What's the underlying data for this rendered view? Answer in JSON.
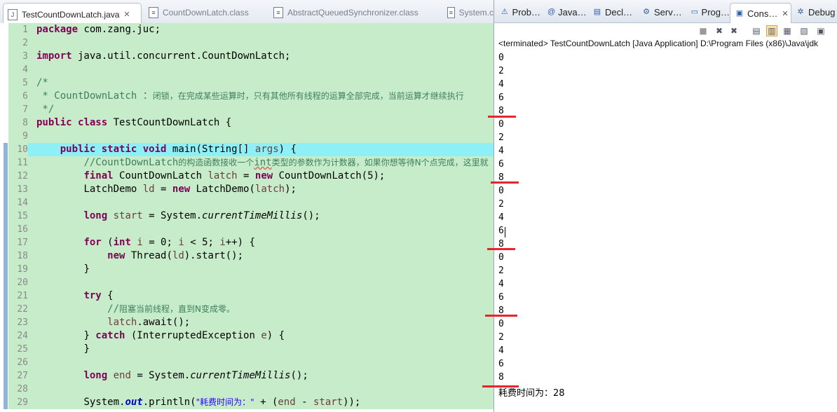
{
  "editor": {
    "tabs": [
      {
        "label": "TestCountDownLatch.java",
        "close": "✕"
      },
      {
        "label": "CountDownLatch.class"
      },
      {
        "label": "AbstractQueuedSynchronizer.class"
      },
      {
        "label": "System.c"
      }
    ],
    "code": {
      "l1": {
        "ln": "1",
        "a": "package",
        "b": " com.zang.juc;"
      },
      "l2": {
        "ln": "2"
      },
      "l3": {
        "ln": "3",
        "a": "import",
        "b": " java.util.concurrent.CountDownLatch;"
      },
      "l4": {
        "ln": "4"
      },
      "l5": {
        "ln": "5",
        "a": "/*"
      },
      "l6": {
        "ln": "6",
        "a": " * CountDownLatch ：",
        "b": "闭锁，在完成某些运算时，只有其他所有线程的运算全部完成，当前运算才继续执行"
      },
      "l7": {
        "ln": "7",
        "a": " */"
      },
      "l8": {
        "ln": "8",
        "a": "public",
        "b": "class",
        "c": " TestCountDownLatch {"
      },
      "l9": {
        "ln": "9"
      },
      "l10": {
        "ln": "10",
        "a": "public",
        "b": "static",
        "c": "void",
        "d": " main(String[] ",
        "e": "args",
        "f": ") {"
      },
      "l11": {
        "ln": "11",
        "a": "//CountDownLatch",
        "b": "的构造函数接收一个",
        "c": "int",
        "d": "类型的参数作为计数器，如果你想等待N个点完成，这里就"
      },
      "l12": {
        "ln": "12",
        "a": "final",
        "b": " CountDownLatch ",
        "c": "latch",
        "d": " = ",
        "e": "new",
        "f": " CountDownLatch(5);"
      },
      "l13": {
        "ln": "13",
        "a": "LatchDemo ",
        "b": "ld",
        "c": " = ",
        "d": "new",
        "e": " LatchDemo(",
        "f": "latch",
        "g": ");"
      },
      "l14": {
        "ln": "14"
      },
      "l15": {
        "ln": "15",
        "a": "long",
        "b": "start",
        "c": " = System.",
        "d": "currentTimeMillis",
        "e": "();"
      },
      "l16": {
        "ln": "16"
      },
      "l17": {
        "ln": "17",
        "a": "for",
        "b": " (",
        "c": "int",
        "d": "i",
        "e": " = 0; ",
        "f": "i",
        "g": " < 5; ",
        "h": "i",
        "i": "++) {"
      },
      "l18": {
        "ln": "18",
        "a": "new",
        "b": " Thread(",
        "c": "ld",
        "d": ").start();"
      },
      "l19": {
        "ln": "19",
        "a": "}"
      },
      "l20": {
        "ln": "20"
      },
      "l21": {
        "ln": "21",
        "a": "try",
        "b": " {"
      },
      "l22": {
        "ln": "22",
        "a": "//",
        "b": "阻塞当前线程，直到N变成零。"
      },
      "l23": {
        "ln": "23",
        "a": "latch",
        "b": ".await();"
      },
      "l24": {
        "ln": "24",
        "a": "} ",
        "b": "catch",
        "c": " (InterruptedException ",
        "d": "e",
        "e": ") {"
      },
      "l25": {
        "ln": "25",
        "a": "}"
      },
      "l26": {
        "ln": "26"
      },
      "l27": {
        "ln": "27",
        "a": "long",
        "b": "end",
        "c": " = System.",
        "d": "currentTimeMillis",
        "e": "();"
      },
      "l28": {
        "ln": "28"
      },
      "l29": {
        "ln": "29",
        "a": "System.",
        "b": "out",
        "c": ".println(",
        "d": "\"耗费时间为：\"",
        "e": " + (",
        "f": "end",
        "g": " - ",
        "h": "start",
        "i": "));"
      }
    }
  },
  "console": {
    "tabs": [
      "Prob…",
      "Java…",
      "Decl…",
      "Serv…",
      "Prog…",
      "Cons…",
      "Debug"
    ],
    "status": "<terminated> TestCountDownLatch [Java Application] D:\\Program Files (x86)\\Java\\jdk",
    "output": [
      "0",
      "2",
      "4",
      "6",
      "8",
      "0",
      "2",
      "4",
      "6",
      "8",
      "0",
      "2",
      "4",
      "6",
      "8",
      "0",
      "2",
      "4",
      "6",
      "8",
      "0",
      "2",
      "4",
      "6",
      "8"
    ],
    "final_line": "耗费时间为：28"
  },
  "colors": {
    "editor_line_bg": "#c7ecc9",
    "current_line_bg": "#8df0f7",
    "keyword": "#7f0055",
    "comment": "#3f7f5f",
    "string": "#2a00ff",
    "annotation_red": "#e5272d"
  }
}
